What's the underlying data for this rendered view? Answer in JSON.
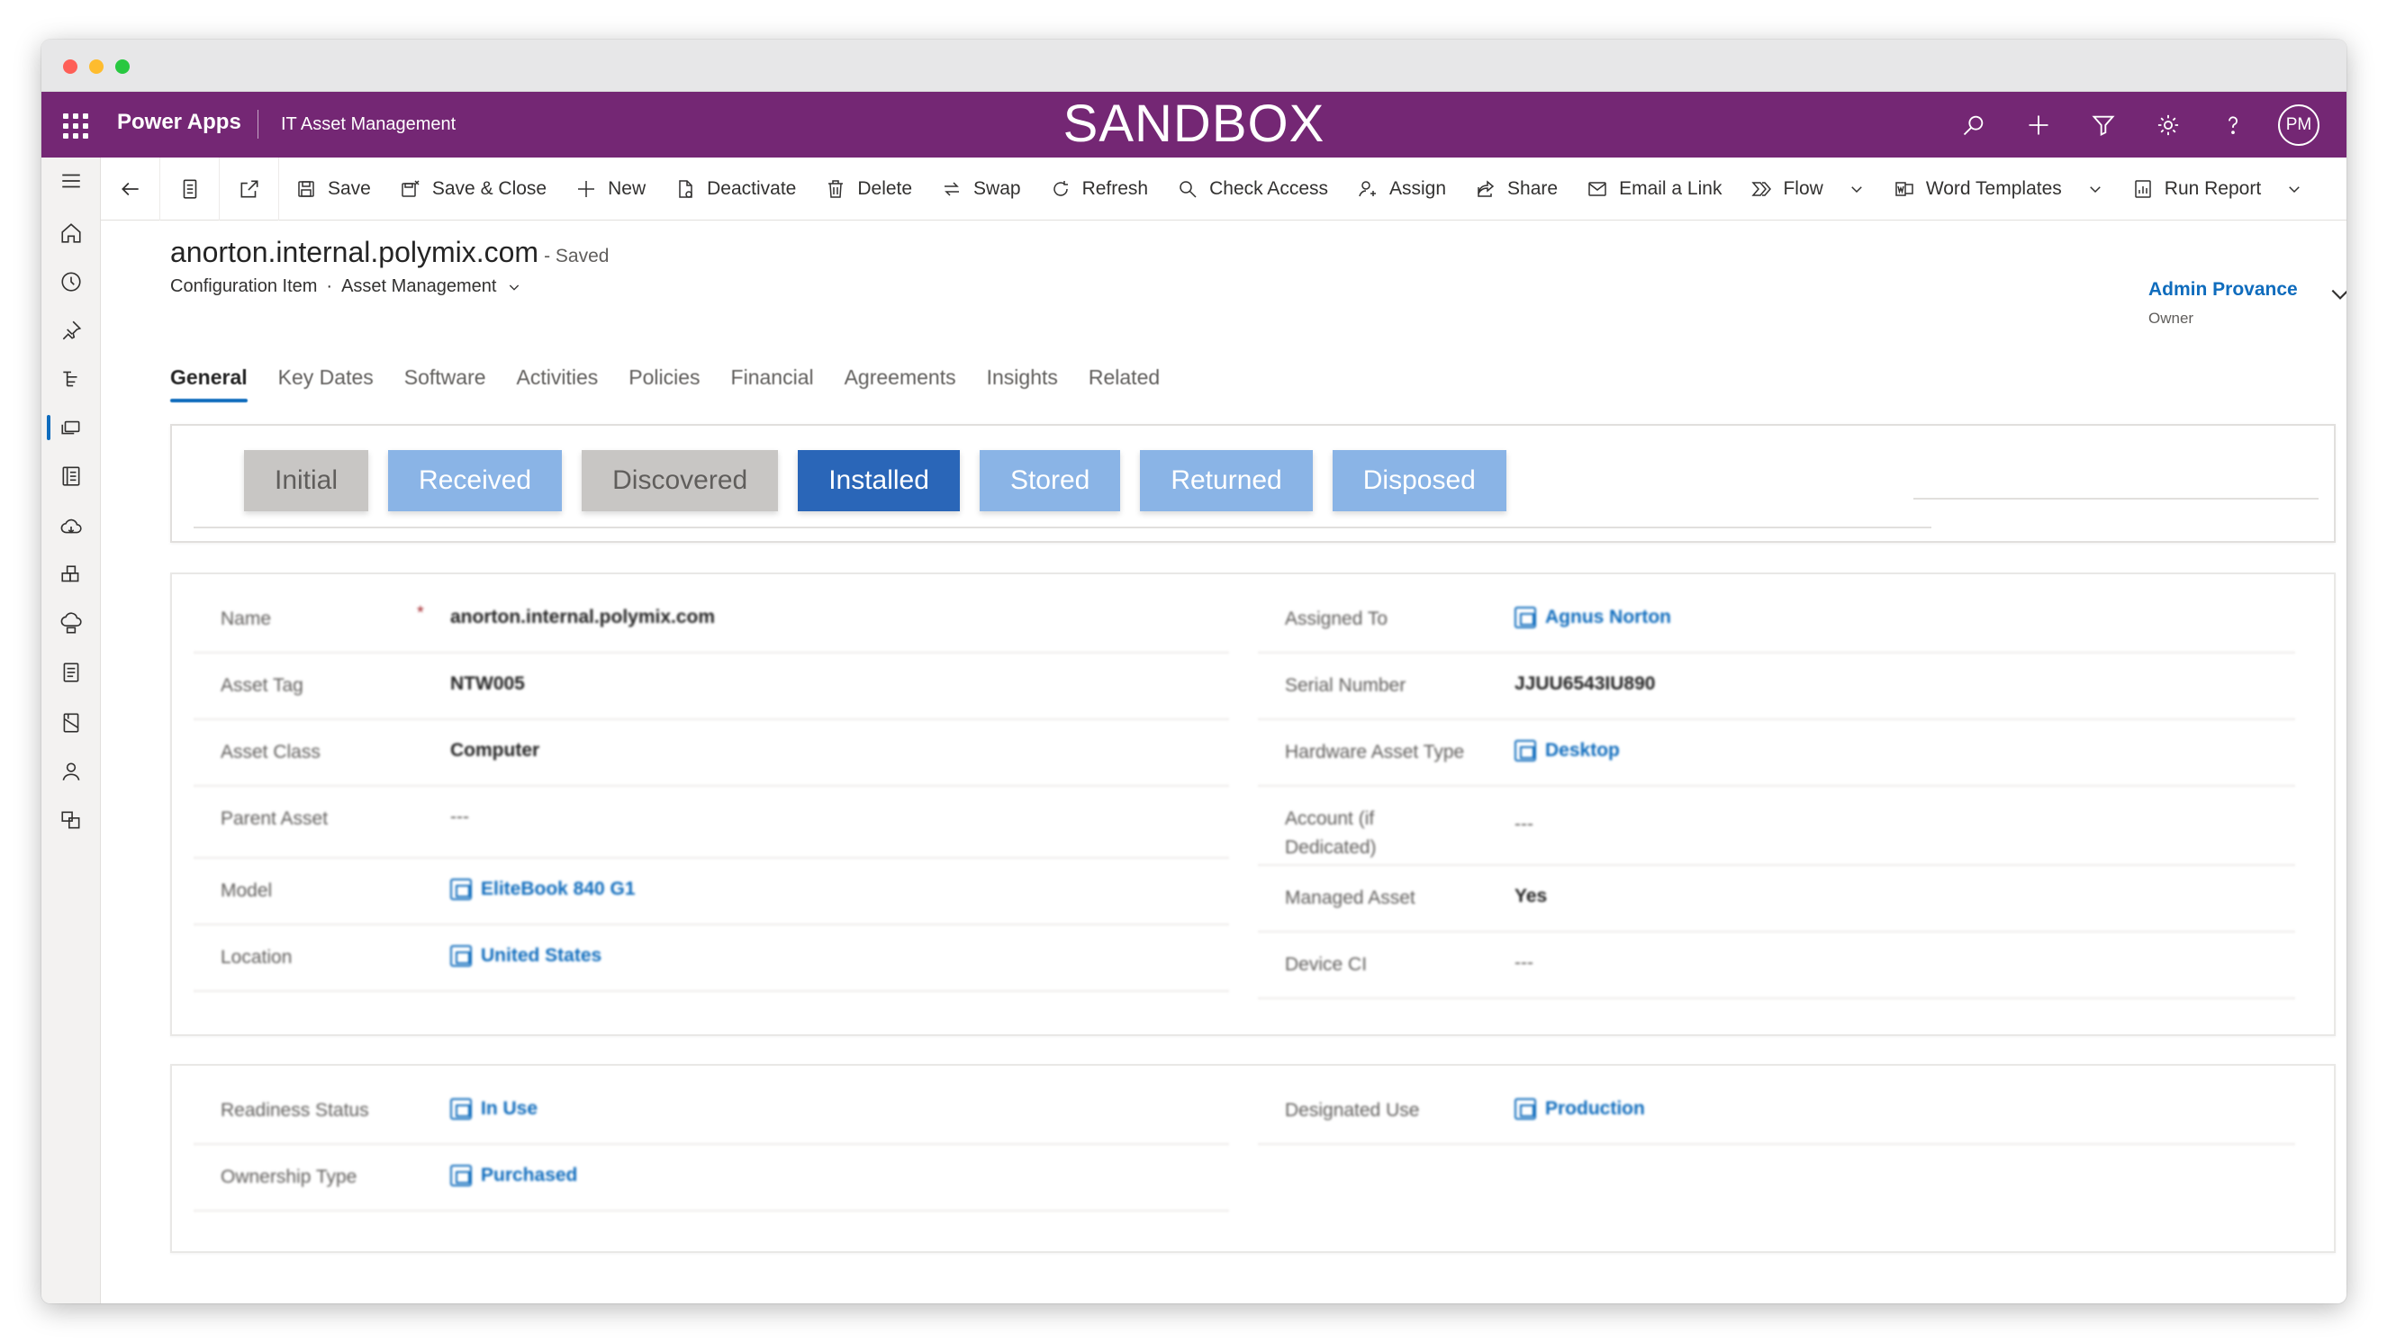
{
  "app": {
    "brand": "Power Apps",
    "name": "IT Asset Management",
    "environment": "SANDBOX",
    "user_initials": "PM"
  },
  "commands": [
    {
      "label": "Save",
      "icon": "save-icon"
    },
    {
      "label": "Save & Close",
      "icon": "save-close-icon"
    },
    {
      "label": "New",
      "icon": "plus-icon"
    },
    {
      "label": "Deactivate",
      "icon": "deactivate-icon"
    },
    {
      "label": "Delete",
      "icon": "delete-icon"
    },
    {
      "label": "Swap",
      "icon": "swap-icon"
    },
    {
      "label": "Refresh",
      "icon": "refresh-icon"
    },
    {
      "label": "Check Access",
      "icon": "check-access-icon"
    },
    {
      "label": "Assign",
      "icon": "assign-icon"
    },
    {
      "label": "Share",
      "icon": "share-icon"
    },
    {
      "label": "Email a Link",
      "icon": "email-icon"
    },
    {
      "label": "Flow",
      "icon": "flow-icon"
    },
    {
      "label": "Word Templates",
      "icon": "word-icon"
    },
    {
      "label": "Run Report",
      "icon": "report-icon"
    }
  ],
  "record": {
    "title": "anorton.internal.polymix.com",
    "status": "- Saved",
    "entity": "Configuration Item",
    "form": "Asset Management",
    "owner_name": "Admin Provance",
    "owner_label": "Owner"
  },
  "tabs": [
    "General",
    "Key Dates",
    "Software",
    "Activities",
    "Policies",
    "Financial",
    "Agreements",
    "Insights",
    "Related"
  ],
  "stages": [
    "Initial",
    "Received",
    "Discovered",
    "Installed",
    "Stored",
    "Returned",
    "Disposed"
  ],
  "fields_left": [
    {
      "label": "Name",
      "value": "anorton.internal.polymix.com"
    },
    {
      "label": "Asset Tag",
      "value": "NTW005"
    },
    {
      "label": "Asset Class",
      "value": "Computer"
    },
    {
      "label": "Parent Asset",
      "value": "---"
    },
    {
      "label": "Model",
      "value": "EliteBook 840 G1"
    },
    {
      "label": "Location",
      "value": "United States"
    }
  ],
  "fields_right": [
    {
      "label": "Assigned To",
      "value": "Agnus Norton"
    },
    {
      "label": "Serial Number",
      "value": "JJUU6543IU890"
    },
    {
      "label": "Hardware Asset Type",
      "value": "Desktop"
    },
    {
      "label": "Account (if Dedicated)",
      "value": "---"
    },
    {
      "label": "Managed Asset",
      "value": "Yes"
    },
    {
      "label": "Device CI",
      "value": "---"
    }
  ],
  "fields2_left": [
    {
      "label": "Readiness Status",
      "value": "In Use"
    },
    {
      "label": "Ownership Type",
      "value": "Purchased"
    }
  ],
  "fields2_right": [
    {
      "label": "Designated Use",
      "value": "Production"
    }
  ],
  "colors": {
    "appbar": "#742774",
    "stage_current": "#2a66b8",
    "stage_active": "#8ab4e6",
    "stage_inactive": "#c8c6c4",
    "link": "#0f6cbd"
  }
}
